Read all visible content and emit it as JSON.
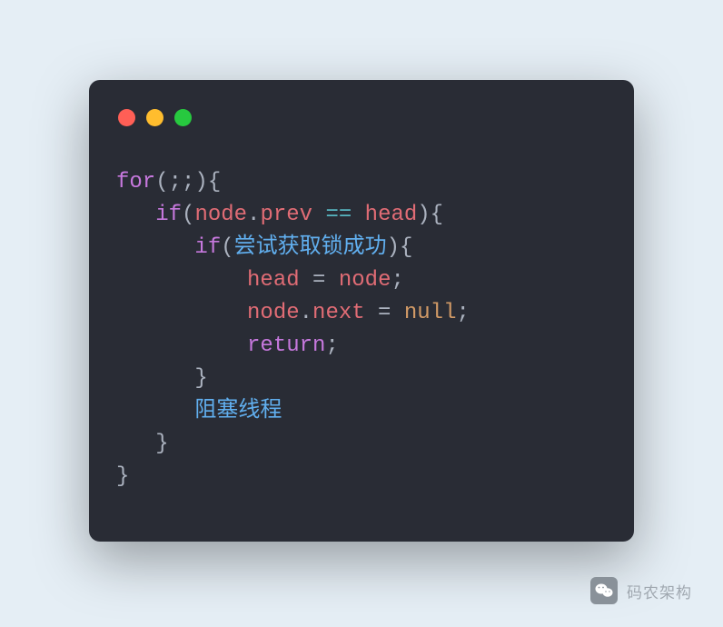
{
  "code": {
    "line1": {
      "kw": "for",
      "rest": "(;;){"
    },
    "line2": {
      "indent": "   ",
      "kw": "if",
      "open": "(",
      "ident1": "node",
      "dot": ".",
      "prop": "prev",
      "op": " == ",
      "ident2": "head",
      "close": "){"
    },
    "line3": {
      "indent": "      ",
      "kw": "if",
      "open": "(",
      "text": "尝试获取锁成功",
      "close": "){"
    },
    "line4": {
      "indent": "          ",
      "ident1": "head",
      "eq": " = ",
      "ident2": "node",
      "semi": ";"
    },
    "line5": {
      "indent": "          ",
      "ident": "node",
      "dot": ".",
      "prop": "next",
      "eq": " = ",
      "null": "null",
      "semi": ";"
    },
    "line6": {
      "indent": "          ",
      "kw": "return",
      "semi": ";"
    },
    "line7": {
      "indent": "      ",
      "brace": "}"
    },
    "line8": {
      "indent": "      ",
      "text": "阻塞线程"
    },
    "line9": {
      "indent": "   ",
      "brace": "}"
    },
    "line10": {
      "brace": "}"
    }
  },
  "watermark": {
    "text": "码农架构"
  }
}
